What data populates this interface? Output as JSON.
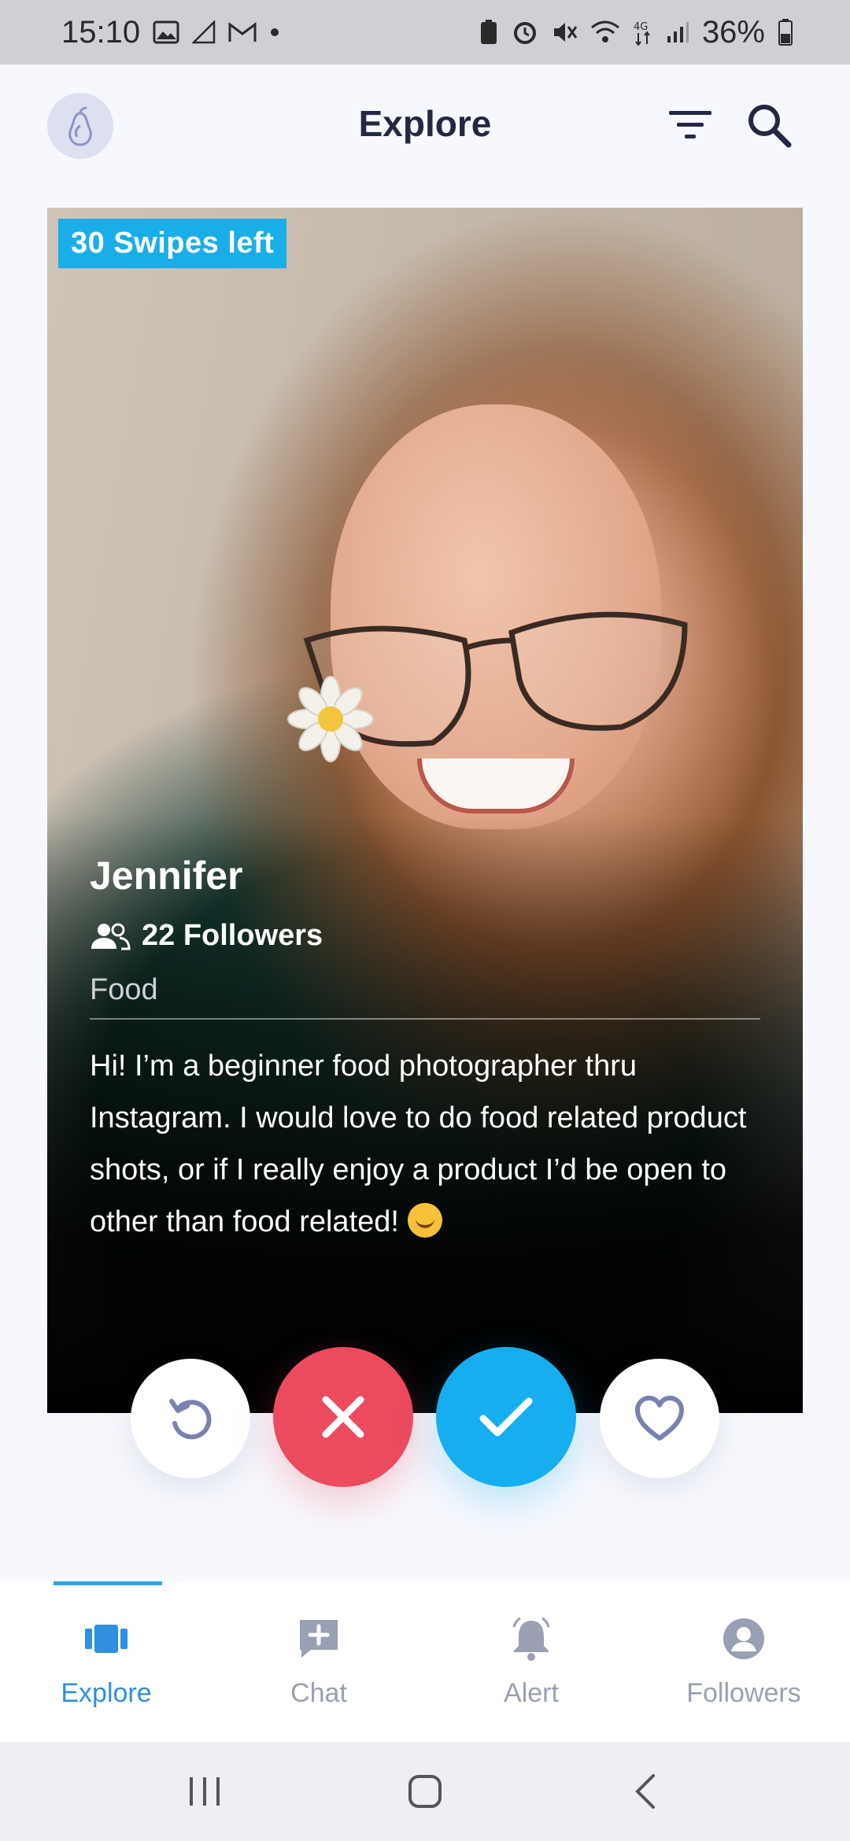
{
  "status_bar": {
    "time": "15:10",
    "battery": "36%",
    "left_icons": [
      "image-icon",
      "no-signal-icon",
      "gmail-icon",
      "dot-icon"
    ],
    "right_icons": [
      "battery-saver-icon",
      "alarm-icon",
      "mute-icon",
      "wifi-icon",
      "4g-icon",
      "signal-icon",
      "battery-icon"
    ]
  },
  "header": {
    "title": "Explore",
    "logo_icon": "pear-logo-icon",
    "filter_icon": "filter-icon",
    "search_icon": "search-icon"
  },
  "card": {
    "swipes_left": "30 Swipes left",
    "name": "Jennifer",
    "followers": "22 Followers",
    "category": "Food",
    "bio": "Hi! I’m a beginner food photographer thru Instagram. I would love to do food related product shots, or if I really enjoy a product I’d be open to other than food related!"
  },
  "actions": {
    "undo_icon": "undo-icon",
    "reject_icon": "close-icon",
    "accept_icon": "check-icon",
    "like_icon": "heart-icon"
  },
  "bottom_nav": {
    "tabs": [
      {
        "label": "Explore",
        "icon": "cards-icon",
        "active": true
      },
      {
        "label": "Chat",
        "icon": "chat-add-icon",
        "active": false
      },
      {
        "label": "Alert",
        "icon": "bell-icon",
        "active": false
      },
      {
        "label": "Followers",
        "icon": "user-circle-icon",
        "active": false
      }
    ]
  },
  "colors": {
    "accent": "#17aef0",
    "reject": "#ec4a5e",
    "active_tab": "#2f8fe0",
    "inactive_tab": "#9aa0b4",
    "title": "#242844"
  }
}
